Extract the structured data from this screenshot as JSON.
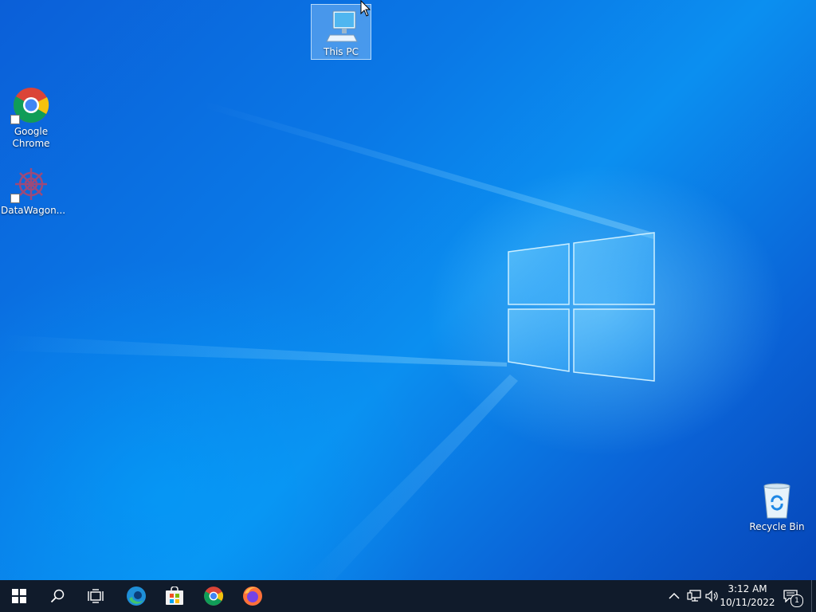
{
  "desktop": {
    "icons": [
      {
        "label": "This PC",
        "icon": "this-pc-icon"
      },
      {
        "label": "Google\nChrome",
        "icon": "chrome-icon"
      },
      {
        "label": "DataWagon...",
        "icon": "datawagon-icon"
      },
      {
        "label": "Recycle Bin",
        "icon": "recycle-bin-icon"
      }
    ]
  },
  "taskbar": {
    "buttons": [
      {
        "icon": "windows-start-icon"
      },
      {
        "icon": "search-icon"
      },
      {
        "icon": "task-view-icon"
      },
      {
        "icon": "edge-icon"
      },
      {
        "icon": "microsoft-store-icon"
      },
      {
        "icon": "chrome-icon"
      },
      {
        "icon": "firefox-icon"
      }
    ],
    "tray": {
      "icons": [
        "chevron-up-icon",
        "network-icon",
        "volume-icon"
      ],
      "time": "3:12 AM",
      "date": "10/11/2022",
      "notification_count": "1"
    }
  },
  "colors": {
    "taskbar_bg": "#101b2b",
    "desktop_blue": "#0a78e6"
  }
}
